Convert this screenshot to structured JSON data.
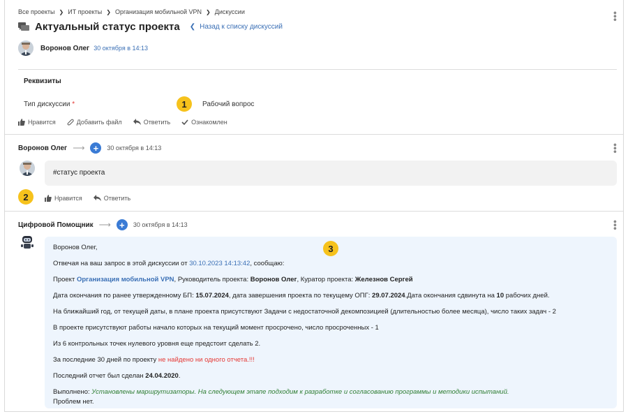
{
  "breadcrumb": [
    "Все проекты",
    "ИТ проекты",
    "Организация мобильной VPN",
    "Дискуссии"
  ],
  "header": {
    "title": "Актуальный статус проекта",
    "back_link": "Назад к списку дискуссий",
    "author": "Воронов Олег",
    "date": "30 октября в 14:13"
  },
  "requisites": {
    "title": "Реквизиты",
    "field_label": "Тип дискуссии",
    "required_mark": "*",
    "field_value": "Рабочий вопрос"
  },
  "badges": [
    "1",
    "2",
    "3"
  ],
  "post_actions": {
    "like": "Нравится",
    "add_file": "Добавить файл",
    "reply": "Ответить",
    "acknowledged": "Ознакомлен"
  },
  "comment1": {
    "author": "Воронов Олег",
    "date": "30 октября в 14:13",
    "text": "#статус проекта",
    "like": "Нравится",
    "reply": "Ответить"
  },
  "comment2": {
    "author": "Цифровой Помощник",
    "date": "30 октября в 14:13",
    "greeting": "Воронов Олег,",
    "l2_pre": "Отвечая на ваш запрос в этой дискуссии от ",
    "l2_link": "30.10.2023 14:13:42",
    "l2_post": ", сообщаю:",
    "l3_pre": "Проект ",
    "l3_project": "Организация мобильной VPN",
    "l3_mid1": ", Руководитель проекта: ",
    "l3_manager": "Воронов Олег",
    "l3_mid2": ", Куратор проекта: ",
    "l3_curator": "Железнов Сергей",
    "l4_pre": "Дата окончания по ранее утвержденному БП: ",
    "l4_d1": "15.07.2024",
    "l4_mid": ", дата завершения проекта по текущему ОПГ: ",
    "l4_d2": "29.07.2024",
    "l4_mid2": ".Дата окончания сдвинута на ",
    "l4_days": "10",
    "l4_post": " рабочих дней.",
    "l5": "На ближайший год, от текущей даты, в плане проекта присутствуют Задачи с недостаточной декомпозицией (длительностью более месяца), число таких задач - 2",
    "l6": "В проекте присутствуют работы начало которых на текущий момент просрочено, число просроченных - 1",
    "l7": "Из 6 контрольных точек нулевого уровня еще предстоит сделать 2.",
    "l8_pre": "За последние 30 дней по проекту ",
    "l8_red": "не найдено ни одного отчета.!!!",
    "l9_pre": "Последний отчет был сделан ",
    "l9_date": "24.04.2020",
    "l9_post": ".",
    "l10_pre": "Выполнено: ",
    "l10_green": "Установлены маршрутизаторы. На следующем этапе подходим к разработке и согласованию программы и методики испытаний.",
    "l11": "Проблем нет."
  },
  "colors": {
    "accent": "#3a7bd5",
    "badge": "#f6c21c",
    "link": "#3a6fb5",
    "alert": "#e53935",
    "success": "#2e7d32",
    "bubble_blue": "#eef5fd",
    "bubble_grey": "#f2f2f2"
  }
}
